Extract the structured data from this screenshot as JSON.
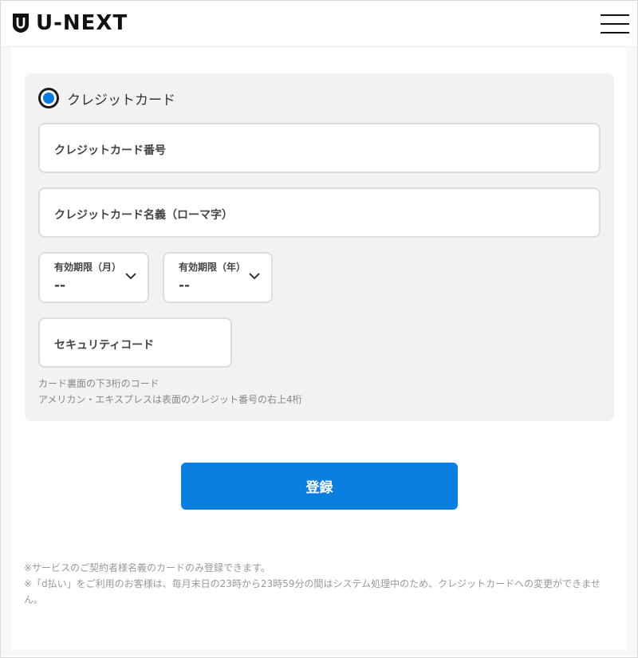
{
  "header": {
    "logo_text": "U-NEXT",
    "menu_icon": "hamburger-menu-icon"
  },
  "payment": {
    "method_label": "クレジットカード",
    "method_selected": true,
    "card_number_placeholder": "クレジットカード番号",
    "card_name_placeholder": "クレジットカード名義（ローマ字）",
    "expiry_month": {
      "label": "有効期限（月）",
      "value": "--"
    },
    "expiry_year": {
      "label": "有効期限（年）",
      "value": "--"
    },
    "security_code_placeholder": "セキュリティコード",
    "hint_line1": "カード裏面の下3桁のコード",
    "hint_line2": "アメリカン・エキスプレスは表面のクレジット番号の右上4桁"
  },
  "submit_label": "登録",
  "notes": {
    "line1": "※サービスのご契約者様名義のカードのみ登録できます。",
    "line2": "※「d払い」をご利用のお客様は、毎月末日の23時から23時59分の間はシステム処理中のため、クレジットカードへの変更ができません。"
  },
  "colors": {
    "accent": "#0a7fe0",
    "panel_bg": "#f2f2f2",
    "text": "#333333"
  }
}
